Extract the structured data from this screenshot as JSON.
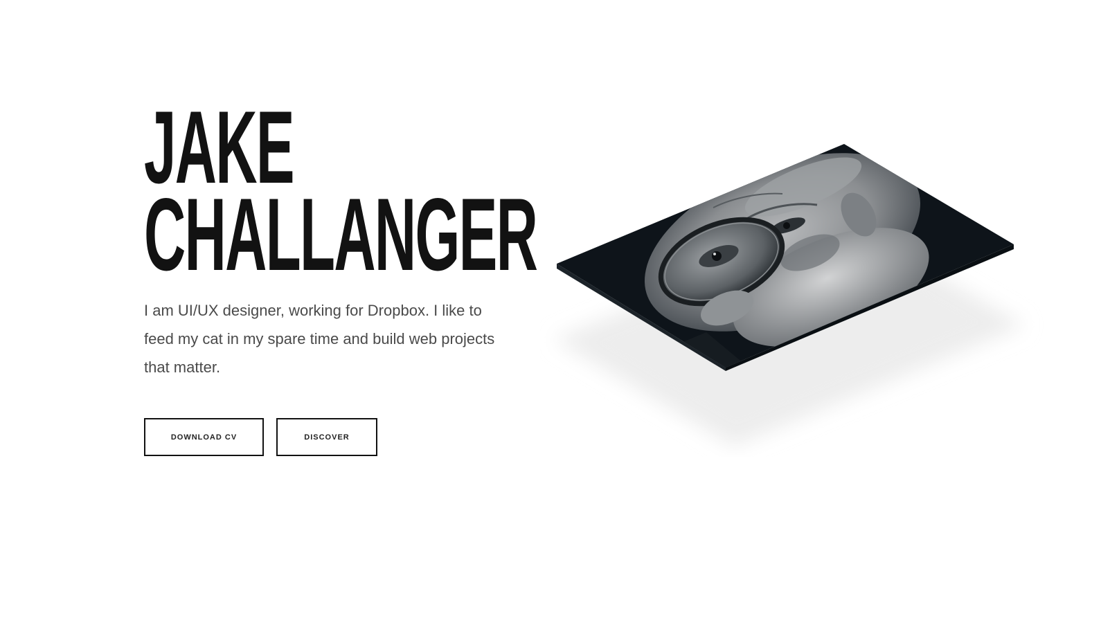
{
  "hero": {
    "name_line1": "JAKE",
    "name_line2": "CHALLANGER",
    "intro": "I am UI/UX designer, working for Dropbox. I like to feed my cat in my spare time and build web projects that matter."
  },
  "buttons": {
    "download_label": "DOWNLOAD CV",
    "discover_label": "DISCOVER"
  },
  "photo": {
    "subject": "portrait-with-magnifying-glass",
    "style": "isometric-tilted-grayscale"
  },
  "colors": {
    "background": "#ffffff",
    "text": "#111111",
    "muted_text": "#4a4a4a",
    "photo_dark": "#0e141a",
    "shadow": "#efefef"
  }
}
